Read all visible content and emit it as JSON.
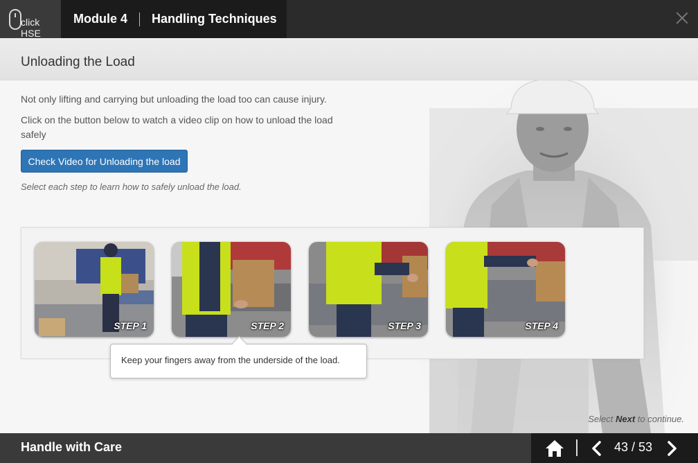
{
  "header": {
    "logo_text": "click HSE",
    "module_number": "Module 4",
    "module_title": "Handling Techniques"
  },
  "page": {
    "title": "Unloading the Load",
    "intro": "Not only lifting and carrying but unloading the load too can cause injury.",
    "instruction": "Click on the button below to watch a video clip on how to unload the load safely",
    "video_button": "Check Video for Unloading the load",
    "select_hint": "Select each step to learn how to safely unload the load."
  },
  "steps": [
    {
      "label": "STEP 1"
    },
    {
      "label": "STEP 2"
    },
    {
      "label": "STEP 3"
    },
    {
      "label": "STEP 4"
    }
  ],
  "tooltip": "Keep your fingers away from the underside of the load.",
  "next_hint": {
    "prefix": "Select ",
    "keyword": "Next",
    "suffix": " to continue."
  },
  "footer": {
    "course_title": "Handle with Care",
    "page_indicator": "43 / 53"
  },
  "colors": {
    "accent": "#2e75b6",
    "header_bg": "#2b2b2b",
    "module_bg": "#1b1b1b",
    "vest": "#d4e600"
  }
}
